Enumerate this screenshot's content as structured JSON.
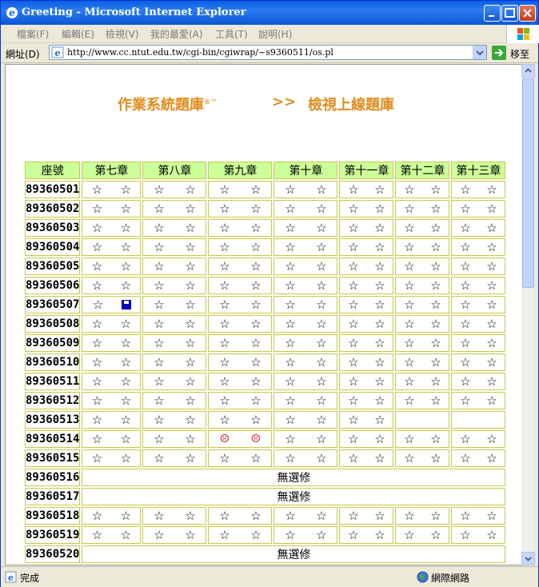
{
  "window": {
    "title": "Greeting - Microsoft Internet Explorer"
  },
  "menu": [
    "檔案(F)",
    "編輯(E)",
    "檢視(V)",
    "我的最愛(A)",
    "工具(T)",
    "說明(H)"
  ],
  "address": {
    "label": "網址(D)",
    "url": "http://www.cc.ntut.edu.tw/cgi-bin/cgiwrap/~s9360511/os.pl",
    "go": "移至"
  },
  "status": {
    "text": "完成",
    "zone": "網際網路"
  },
  "page": {
    "title": "作業系統題庫",
    "mark": "®™",
    "arrow": ">>",
    "subtitle": "檢視上線題庫"
  },
  "table": {
    "headers": [
      "座號",
      "第七章",
      "第八章",
      "第九章",
      "第十章",
      "第十一章",
      "第十二章",
      "第十三章"
    ],
    "no_elective": "無選修",
    "rows": [
      {
        "id": "89360501",
        "cells": [
          [
            "star",
            "star"
          ],
          [
            "star",
            "star"
          ],
          [
            "star",
            "star"
          ],
          [
            "star",
            "star"
          ],
          [
            "star",
            "star"
          ],
          [
            "star",
            "star"
          ],
          [
            "star",
            "star"
          ]
        ]
      },
      {
        "id": "89360502",
        "cells": [
          [
            "star",
            "star"
          ],
          [
            "star",
            "star"
          ],
          [
            "star",
            "star"
          ],
          [
            "star",
            "star"
          ],
          [
            "star",
            "star"
          ],
          [
            "star",
            "star"
          ],
          [
            "star",
            "star"
          ]
        ]
      },
      {
        "id": "89360503",
        "cells": [
          [
            "star",
            "star"
          ],
          [
            "star",
            "star"
          ],
          [
            "star",
            "star"
          ],
          [
            "star",
            "star"
          ],
          [
            "star",
            "star"
          ],
          [
            "star",
            "star"
          ],
          [
            "star",
            "star"
          ]
        ]
      },
      {
        "id": "89360504",
        "cells": [
          [
            "star",
            "star"
          ],
          [
            "star",
            "star"
          ],
          [
            "star",
            "star"
          ],
          [
            "star",
            "star"
          ],
          [
            "star",
            "star"
          ],
          [
            "star",
            "star"
          ],
          [
            "star",
            "star"
          ]
        ]
      },
      {
        "id": "89360505",
        "cells": [
          [
            "star",
            "star"
          ],
          [
            "star",
            "star"
          ],
          [
            "star",
            "star"
          ],
          [
            "star",
            "star"
          ],
          [
            "star",
            "star"
          ],
          [
            "star",
            "star"
          ],
          [
            "star",
            "star"
          ]
        ]
      },
      {
        "id": "89360506",
        "cells": [
          [
            "star",
            "star"
          ],
          [
            "star",
            "star"
          ],
          [
            "star",
            "star"
          ],
          [
            "star",
            "star"
          ],
          [
            "star",
            "star"
          ],
          [
            "star",
            "star"
          ],
          [
            "star",
            "star"
          ]
        ]
      },
      {
        "id": "89360507",
        "cells": [
          [
            "star",
            "disk"
          ],
          [
            "star",
            "star"
          ],
          [
            "star",
            "star"
          ],
          [
            "star",
            "star"
          ],
          [
            "star",
            "star"
          ],
          [
            "star",
            "star"
          ],
          [
            "star",
            "star"
          ]
        ]
      },
      {
        "id": "89360508",
        "cells": [
          [
            "star",
            "star"
          ],
          [
            "star",
            "star"
          ],
          [
            "star",
            "star"
          ],
          [
            "star",
            "star"
          ],
          [
            "star",
            "star"
          ],
          [
            "star",
            "star"
          ],
          [
            "star",
            "star"
          ]
        ]
      },
      {
        "id": "89360509",
        "cells": [
          [
            "star",
            "star"
          ],
          [
            "star",
            "star"
          ],
          [
            "star",
            "star"
          ],
          [
            "star",
            "star"
          ],
          [
            "star",
            "star"
          ],
          [
            "star",
            "star"
          ],
          [
            "star",
            "star"
          ]
        ]
      },
      {
        "id": "89360510",
        "cells": [
          [
            "star",
            "star"
          ],
          [
            "star",
            "star"
          ],
          [
            "star",
            "star"
          ],
          [
            "star",
            "star"
          ],
          [
            "star",
            "star"
          ],
          [
            "star",
            "star"
          ],
          [
            "star",
            "star"
          ]
        ]
      },
      {
        "id": "89360511",
        "cells": [
          [
            "star",
            "star"
          ],
          [
            "star",
            "star"
          ],
          [
            "star",
            "star"
          ],
          [
            "star",
            "star"
          ],
          [
            "star",
            "star"
          ],
          [
            "star",
            "star"
          ],
          [
            "star",
            "star"
          ]
        ]
      },
      {
        "id": "89360512",
        "cells": [
          [
            "star",
            "star"
          ],
          [
            "star",
            "star"
          ],
          [
            "star",
            "star"
          ],
          [
            "star",
            "star"
          ],
          [
            "star",
            "star"
          ],
          [
            "star",
            "star"
          ],
          [
            "star",
            "star"
          ]
        ]
      },
      {
        "id": "89360513",
        "cells": [
          [
            "star",
            "star"
          ],
          [
            "star",
            "star"
          ],
          [
            "star",
            "star"
          ],
          [
            "star",
            "star"
          ],
          [
            "star",
            "star"
          ],
          [],
          []
        ]
      },
      {
        "id": "89360514",
        "cells": [
          [
            "star",
            "star"
          ],
          [
            "star",
            "star"
          ],
          [
            "sad",
            "sad"
          ],
          [
            "star",
            "star"
          ],
          [
            "star",
            "star"
          ],
          [
            "star",
            "star"
          ],
          [
            "star",
            "star"
          ]
        ]
      },
      {
        "id": "89360515",
        "cells": [
          [
            "star",
            "star"
          ],
          [
            "star",
            "star"
          ],
          [
            "star",
            "star"
          ],
          [
            "star",
            "star"
          ],
          [
            "star",
            "star"
          ],
          [
            "star",
            "star"
          ],
          [
            "star",
            "star"
          ]
        ]
      },
      {
        "id": "89360516",
        "elective": false
      },
      {
        "id": "89360517",
        "elective": false
      },
      {
        "id": "89360518",
        "cells": [
          [
            "star",
            "star"
          ],
          [
            "star",
            "star"
          ],
          [
            "star",
            "star"
          ],
          [
            "star",
            "star"
          ],
          [
            "star",
            "star"
          ],
          [
            "star",
            "star"
          ],
          [
            "star",
            "star"
          ]
        ]
      },
      {
        "id": "89360519",
        "cells": [
          [
            "star",
            "star"
          ],
          [
            "star",
            "star"
          ],
          [
            "star",
            "star"
          ],
          [
            "star",
            "star"
          ],
          [
            "star",
            "star"
          ],
          [
            "star",
            "star"
          ],
          [
            "star",
            "star"
          ]
        ]
      },
      {
        "id": "89360520",
        "elective": false
      }
    ]
  },
  "glyphs": {
    "star": "☆",
    "sad": "☹"
  }
}
